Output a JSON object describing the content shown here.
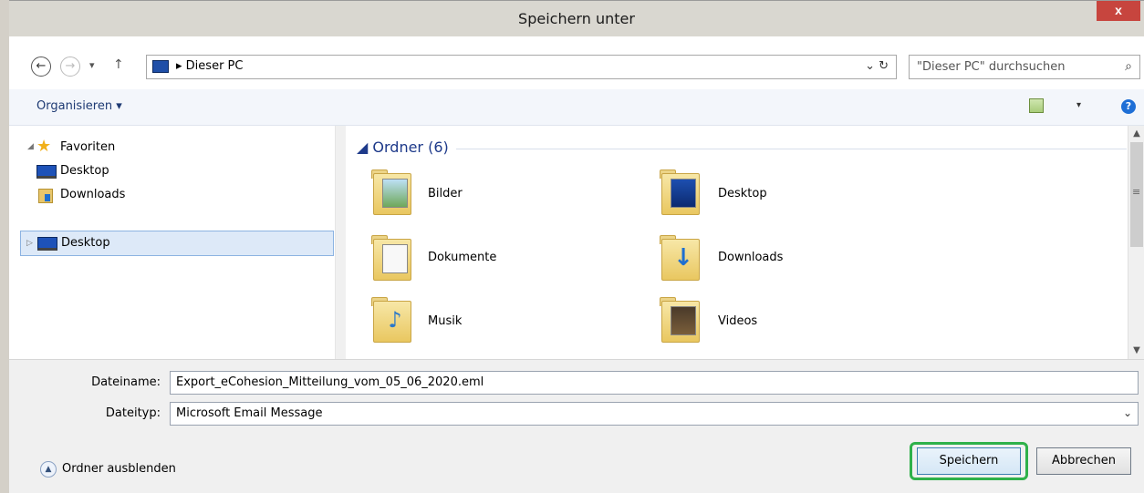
{
  "window": {
    "title": "Speichern unter",
    "close_label": "x"
  },
  "address": {
    "breadcrumb": "Dieser PC",
    "back_glyph": "←",
    "forward_glyph": "→",
    "dropdown_glyph": "▾",
    "up_glyph": "↑",
    "refresh_glyph": "⌄  ↻"
  },
  "search": {
    "placeholder": "\"Dieser PC\" durchsuchen",
    "icon": "⌕"
  },
  "toolbar": {
    "organize_label": "Organisieren ▾",
    "help_label": "?"
  },
  "sidebar": {
    "favorites_label": "Favoriten",
    "items": [
      {
        "label": "Desktop",
        "icon": "desktop-icon"
      },
      {
        "label": "Downloads",
        "icon": "downloads-icon"
      }
    ],
    "tree_desktop_label": "Desktop"
  },
  "content": {
    "group_label": "Ordner (6)",
    "folders": [
      {
        "name": "Bilder",
        "icon": "pictures-folder-icon"
      },
      {
        "name": "Desktop",
        "icon": "desktop-folder-icon"
      },
      {
        "name": "Dokumente",
        "icon": "documents-folder-icon"
      },
      {
        "name": "Downloads",
        "icon": "downloads-folder-icon"
      },
      {
        "name": "Musik",
        "icon": "music-folder-icon"
      },
      {
        "name": "Videos",
        "icon": "videos-folder-icon"
      }
    ]
  },
  "form": {
    "filename_label": "Dateiname:",
    "filename_value": "Export_eCohesion_Mitteilung_vom_05_06_2020.eml",
    "filetype_label": "Dateityp:",
    "filetype_value": "Microsoft Email Message",
    "hide_folders_label": "Ordner ausblenden",
    "save_label": "Speichern",
    "cancel_label": "Abbrechen"
  },
  "colors": {
    "highlight": "#2fb14a",
    "link": "#1e3a73",
    "close": "#c7453e"
  }
}
